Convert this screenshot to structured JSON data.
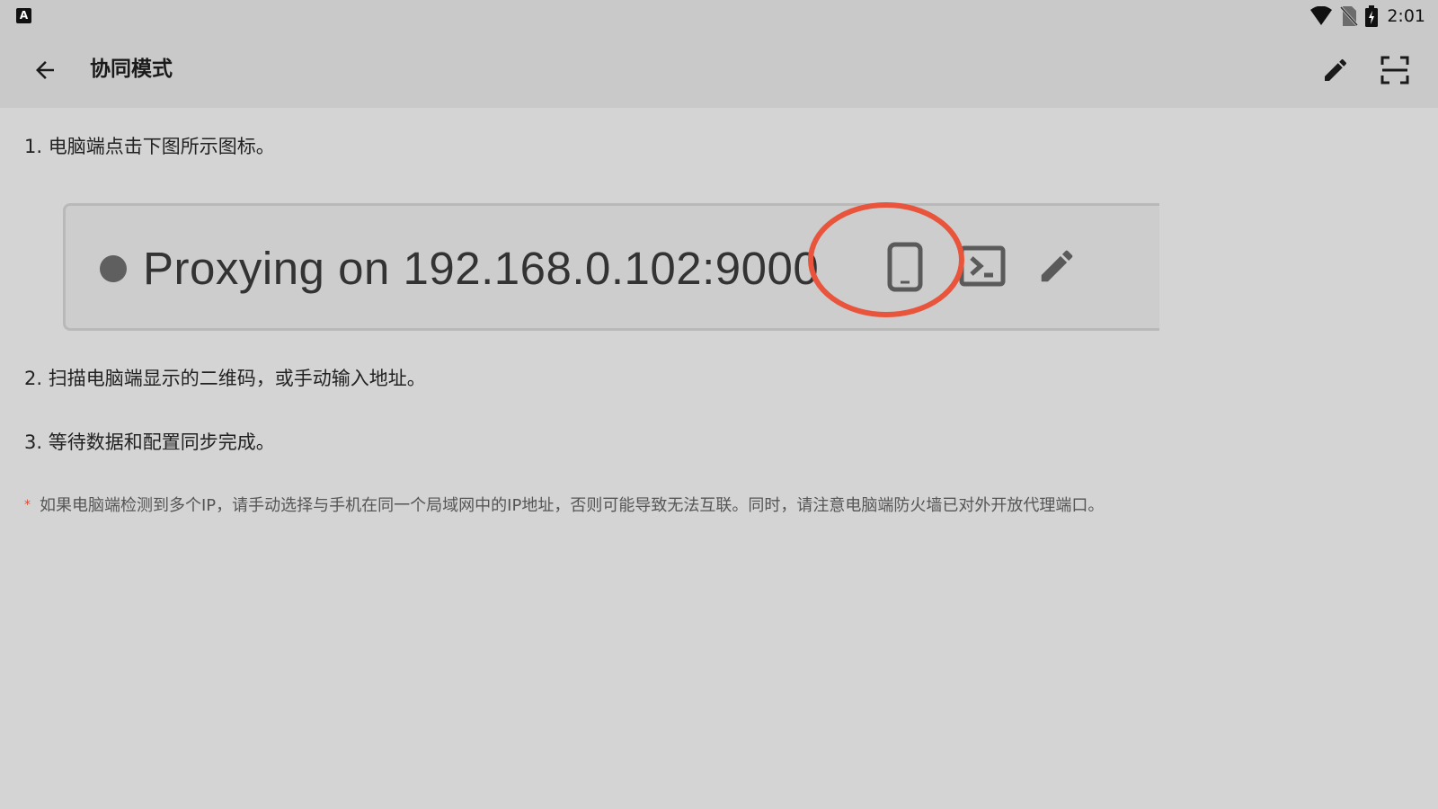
{
  "status_bar": {
    "app_badge": "A",
    "time": "2:01"
  },
  "app_bar": {
    "title": "协同模式"
  },
  "steps": [
    "1. 电脑端点击下图所示图标。",
    "2. 扫描电脑端显示的二维码，或手动输入地址。",
    "3. 等待数据和配置同步完成。"
  ],
  "illustration": {
    "proxy_text": "Proxying on 192.168.0.102:9000"
  },
  "note": {
    "marker": "*",
    "text": "如果电脑端检测到多个IP，请手动选择与手机在同一个局域网中的IP地址，否则可能导致无法互联。同时，请注意电脑端防火墙已对外开放代理端口。"
  },
  "colors": {
    "highlight_ring": "#e9553c",
    "note_marker": "#e9442b"
  }
}
